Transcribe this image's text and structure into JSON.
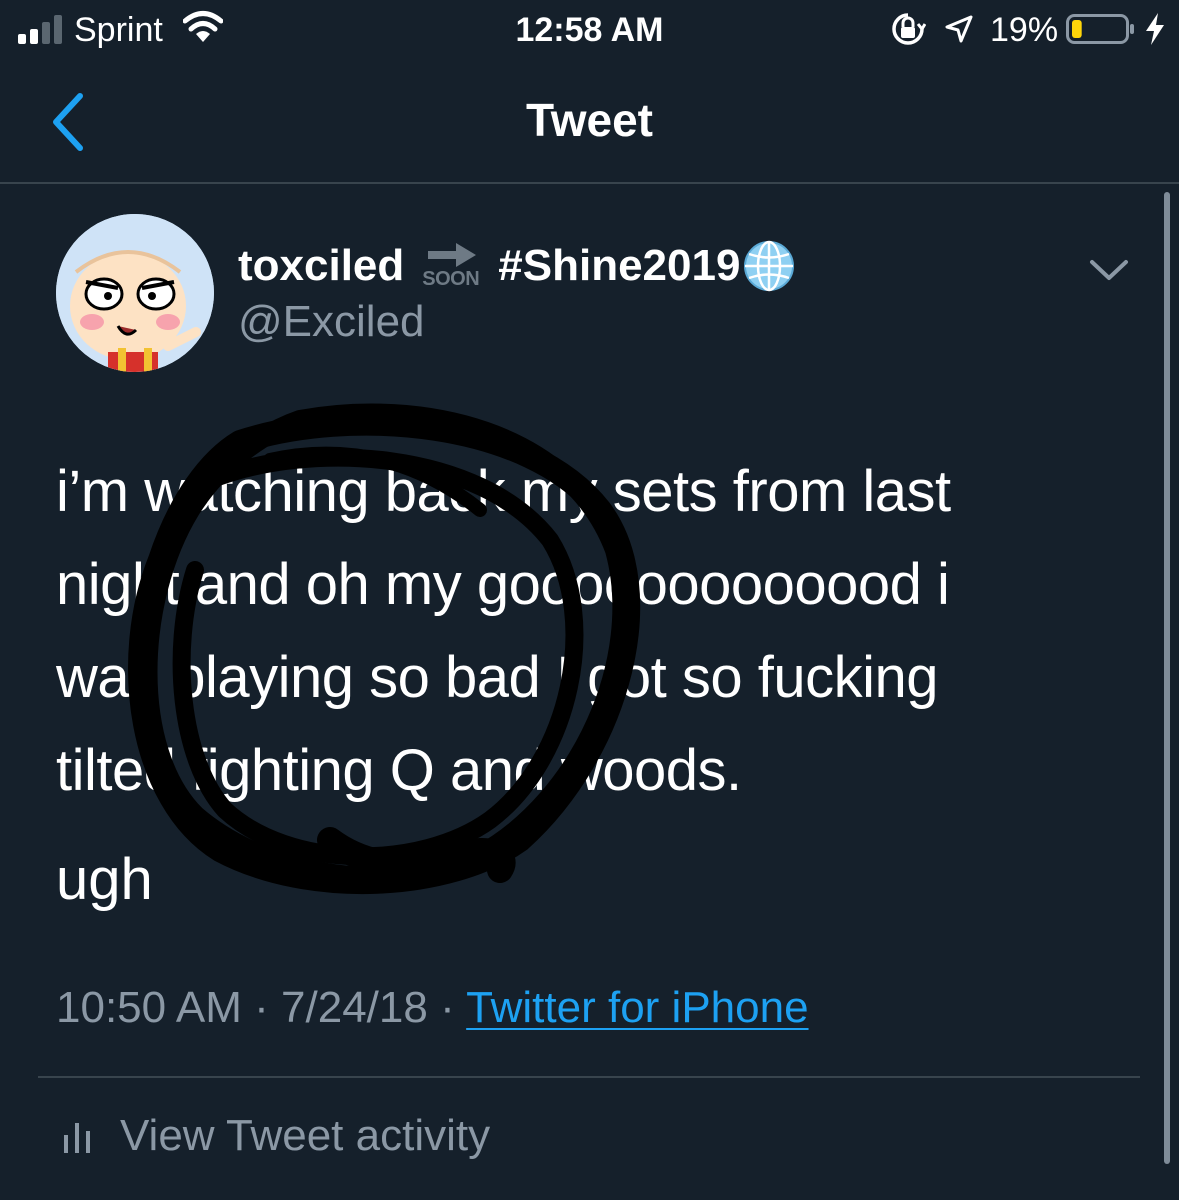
{
  "status_bar": {
    "carrier": "Sprint",
    "time": "12:58 AM",
    "battery_percent": "19%",
    "battery_level": 0.19,
    "icons": [
      "signal-icon",
      "wifi-icon",
      "orientation-lock-icon",
      "location-icon",
      "battery-icon",
      "charging-icon"
    ]
  },
  "nav": {
    "title": "Tweet",
    "back_icon": "chevron-left-icon"
  },
  "tweet": {
    "display_name": "toxciled",
    "name_emoji_label": "SOON",
    "name_hashtag": "#Shine2019",
    "name_emoji_icon": "globe-icon",
    "handle": "@Exciled",
    "menu_icon": "chevron-down-icon",
    "text_lines": [
      "i’m watching back my sets from last",
      "night and oh my gooooooooooood i",
      "was playing so bad I got so fucking",
      "tilted fighting Q and woods."
    ],
    "text_last": "ugh",
    "time": "10:50 AM",
    "date": "7/24/18",
    "separator": "·",
    "source": "Twitter for iPhone"
  },
  "activity": {
    "label": "View Tweet activity",
    "icon": "bar-chart-icon"
  },
  "colors": {
    "background": "#15202b",
    "divider": "#38444d",
    "secondary_text": "#8b98a5",
    "link": "#1da1f2",
    "nav_accent": "#1da1f2",
    "scribble": "#000000"
  }
}
